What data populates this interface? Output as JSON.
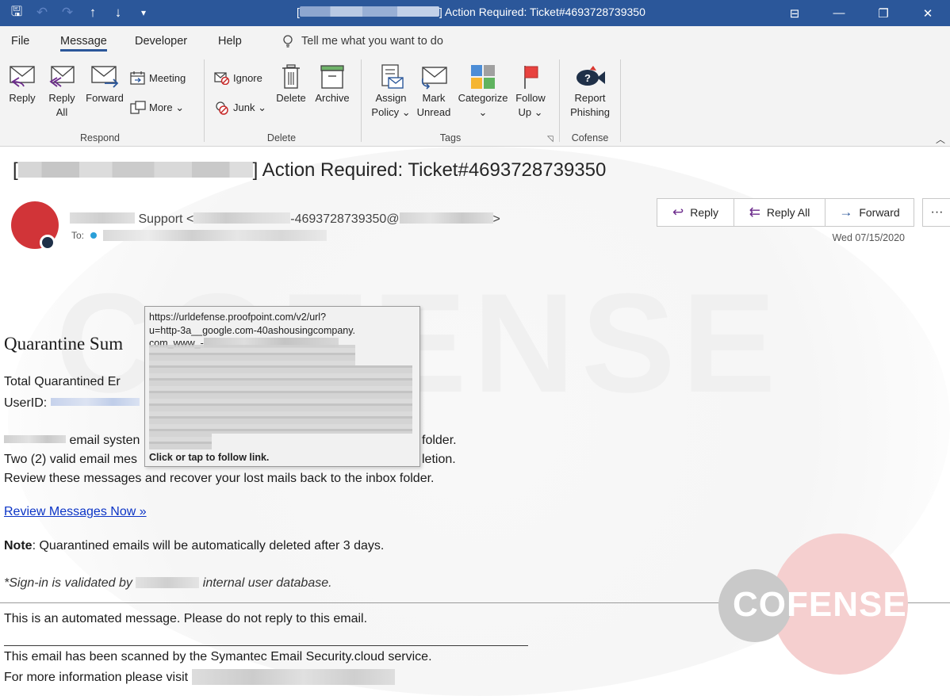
{
  "window": {
    "title_suffix": "] Action Required: Ticket#4693728739350",
    "title_prefix": "[",
    "controls": {
      "ribbon_display": "⊟",
      "minimize": "—",
      "restore": "❐",
      "close": "✕"
    }
  },
  "qat": {
    "save": "🖫",
    "undo": "↶",
    "redo": "↷",
    "up": "↑",
    "down": "↓",
    "customize": "▾"
  },
  "tabs": [
    "File",
    "Message",
    "Developer",
    "Help"
  ],
  "tell_me": {
    "icon": "♀",
    "text": "Tell me what you want to do"
  },
  "ribbon": {
    "respond": {
      "label": "Respond",
      "reply": "Reply",
      "reply_all_1": "Reply",
      "reply_all_2": "All",
      "forward": "Forward",
      "meeting": "Meeting",
      "more": "More ⌄"
    },
    "delete": {
      "label": "Delete",
      "ignore": "Ignore",
      "junk": "Junk ⌄",
      "delete": "Delete",
      "archive": "Archive"
    },
    "tags": {
      "label": "Tags",
      "assign_1": "Assign",
      "assign_2": "Policy ⌄",
      "mark_1": "Mark",
      "mark_2": "Unread",
      "categorize_1": "Categorize",
      "categorize_2": "⌄",
      "follow_1": "Follow",
      "follow_2": "Up ⌄"
    },
    "cofense": {
      "label": "Cofense",
      "report_1": "Report",
      "report_2": "Phishing"
    }
  },
  "message": {
    "subject_open": "[",
    "subject_rest": "] Action Required: Ticket#4693728739350",
    "sender_name": "Support <",
    "sender_ticket": "-4693728739350@",
    "sender_close": ">",
    "to_label": "To:",
    "date": "Wed 07/15/2020",
    "actions": {
      "reply": "Reply",
      "reply_all": "Reply All",
      "forward": "Forward",
      "more": "···"
    }
  },
  "body": {
    "title": "Quarantine Sum",
    "total_line": "Total Quarantined Er",
    "userid_label": "UserID:",
    "system_line": "email systen",
    "system_line_end": "folder.",
    "valid_line": "Two (2) valid email mes",
    "valid_line_end": "letion.",
    "review_line": "Review these messages and recover your lost mails back to the inbox folder.",
    "review_link": "Review Messages Now »",
    "note_label": "Note",
    "note_text": ": Quarantined emails will be automatically deleted after 3 days.",
    "sign_in_1": "*Sign-in is validated by",
    "sign_in_2": "internal user database.",
    "automated": "This is an automated message. Please do not reply to this email.",
    "scanned": "This email has been scanned by the Symantec Email Security.cloud service.",
    "more_info": "For more information please visit"
  },
  "tooltip": {
    "url_line_1": "https://urldefense.proofpoint.com/v2/url?",
    "url_line_2": "u=http-3a__google.com-40ashousingcompany.",
    "url_line_3": "com_www_-",
    "follow_hint": "Click or tap to follow link."
  },
  "watermark": {
    "text": "COFENSE",
    "logo_text": "COFENSE"
  },
  "colors": {
    "title_bar": "#2b579a",
    "avatar": "#d13438",
    "link": "#0b34c6",
    "accent_purple": "#6b2a8b"
  }
}
